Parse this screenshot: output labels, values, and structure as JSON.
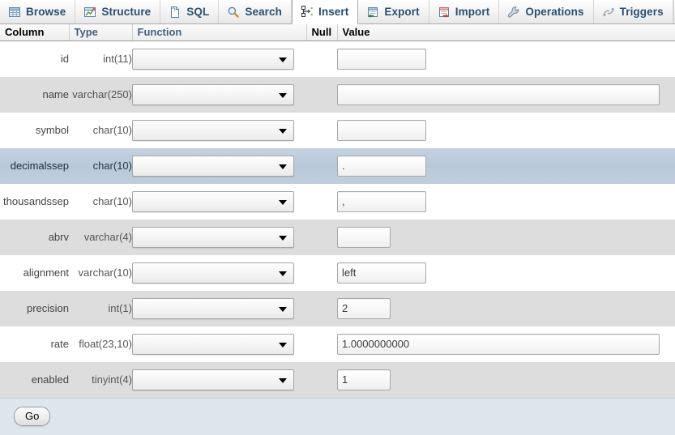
{
  "tabs": [
    {
      "label": "Browse",
      "icon": "browse-grid-icon",
      "active": false
    },
    {
      "label": "Structure",
      "icon": "structure-icon",
      "active": false
    },
    {
      "label": "SQL",
      "icon": "sql-document-icon",
      "active": false
    },
    {
      "label": "Search",
      "icon": "search-icon",
      "active": false
    },
    {
      "label": "Insert",
      "icon": "insert-row-icon",
      "active": true
    },
    {
      "label": "Export",
      "icon": "export-icon",
      "active": false
    },
    {
      "label": "Import",
      "icon": "import-icon",
      "active": false
    },
    {
      "label": "Operations",
      "icon": "wrench-icon",
      "active": false
    },
    {
      "label": "Triggers",
      "icon": "triggers-icon",
      "active": false
    }
  ],
  "table": {
    "headers": {
      "column": "Column",
      "type": "Type",
      "function": "Function",
      "null": "Null",
      "value": "Value"
    },
    "rows": [
      {
        "column": "id",
        "type": "int(11)",
        "function": "",
        "null": "",
        "value": "",
        "value_width": "w-med",
        "shade": "odd"
      },
      {
        "column": "name",
        "type": "varchar(250)",
        "function": "",
        "null": "",
        "value": "",
        "value_width": "w-wide",
        "shade": "even"
      },
      {
        "column": "symbol",
        "type": "char(10)",
        "function": "",
        "null": "",
        "value": "",
        "value_width": "w-med",
        "shade": "odd"
      },
      {
        "column": "decimalssep",
        "type": "char(10)",
        "function": "",
        "null": "",
        "value": ".",
        "value_width": "w-med",
        "shade": "hover"
      },
      {
        "column": "thousandssep",
        "type": "char(10)",
        "function": "",
        "null": "",
        "value": ",",
        "value_width": "w-med",
        "shade": "odd"
      },
      {
        "column": "abrv",
        "type": "varchar(4)",
        "function": "",
        "null": "",
        "value": "",
        "value_width": "w-small",
        "shade": "even"
      },
      {
        "column": "alignment",
        "type": "varchar(10)",
        "function": "",
        "null": "",
        "value": "left",
        "value_width": "w-med",
        "shade": "odd"
      },
      {
        "column": "precision",
        "type": "int(1)",
        "function": "",
        "null": "",
        "value": "2",
        "value_width": "w-small",
        "shade": "even"
      },
      {
        "column": "rate",
        "type": "float(23,10)",
        "function": "",
        "null": "",
        "value": "1.0000000000",
        "value_width": "w-wide",
        "shade": "odd"
      },
      {
        "column": "enabled",
        "type": "tinyint(4)",
        "function": "",
        "null": "",
        "value": "1",
        "value_width": "w-small",
        "shade": "even"
      }
    ]
  },
  "footer": {
    "go_label": "Go"
  },
  "colors": {
    "tab_text": "#2b5070",
    "hover_row": "#bdcbdb",
    "even_row": "#dddddd",
    "footer_bg": "#dde5ed"
  }
}
